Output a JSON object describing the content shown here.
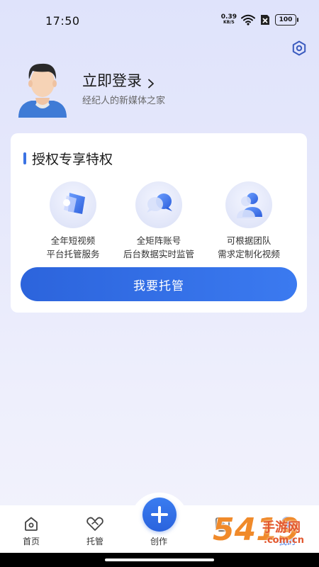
{
  "status_bar": {
    "time": "17:50",
    "net_speed_value": "0.39",
    "net_speed_unit": "KB/S",
    "battery": "100"
  },
  "icons": {
    "settings": "gear-hexagon-icon",
    "wifi": "wifi-icon",
    "sim": "no-sim-icon",
    "avatar": "user-avatar",
    "chevron": "chevron-right-icon"
  },
  "profile": {
    "login_label": "立即登录",
    "subtitle": "经纪人的新媒体之家"
  },
  "privileges": {
    "title": "授权专享特权",
    "features": [
      {
        "line1": "全年短视频",
        "line2": "平台托管服务",
        "icon": "video-tag-icon"
      },
      {
        "line1": "全矩阵账号",
        "line2": "后台数据实时监管",
        "icon": "chat-bubbles-icon"
      },
      {
        "line1": "可根据团队",
        "line2": "需求定制化视频",
        "icon": "team-users-icon"
      }
    ],
    "button_label": "我要托管"
  },
  "bottom_nav": {
    "items": [
      {
        "label": "首页",
        "icon": "home-icon"
      },
      {
        "label": "托管",
        "icon": "handshake-icon"
      },
      {
        "label": "创作",
        "icon": "plus-icon"
      },
      {
        "label": "",
        "icon": "video-play-icon"
      },
      {
        "label": "我的",
        "icon": "profile-icon"
      }
    ],
    "active": "我的"
  },
  "watermark": {
    "brand_number": "5419",
    "brand_text": "手游网",
    "domain": ".com.cn"
  },
  "colors": {
    "accent": "#3b73e3",
    "background_top": "#dfe3fb",
    "card": "#ffffff",
    "watermark": "#e2572e"
  }
}
